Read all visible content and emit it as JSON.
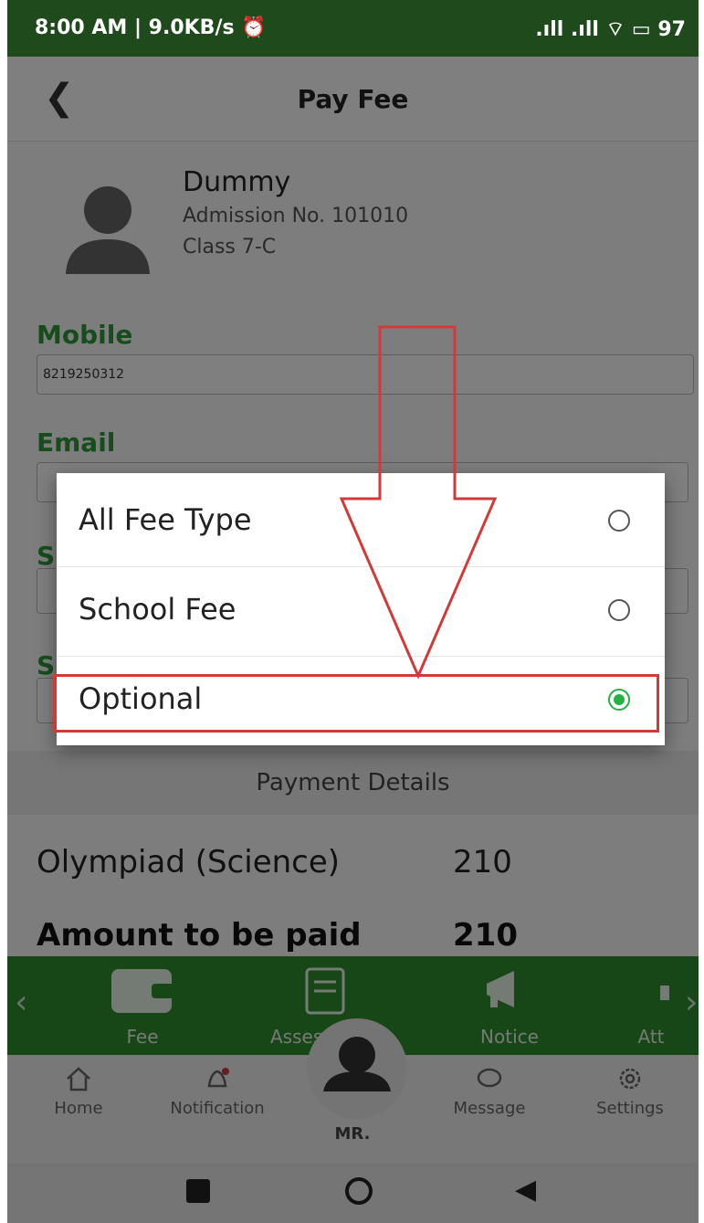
{
  "status": {
    "time": "8:00 AM | 9.0KB/s ⏰",
    "right": ".ıll .ıll ⌔ ▭ 97"
  },
  "header": {
    "title": "Pay Fee"
  },
  "student": {
    "name": "Dummy",
    "admission": "Admission No. 101010",
    "class": "Class 7-C"
  },
  "form": {
    "mobile_label": "Mobile",
    "mobile_value": "8219250312",
    "email_label": "Email",
    "select1_label": "S",
    "select2_label": "S"
  },
  "payment": {
    "section_title": "Payment Details",
    "item_name": "Olympiad (Science)",
    "item_amount": "210",
    "total_label": "Amount to be paid",
    "total_amount": "210"
  },
  "shortcuts": [
    {
      "label": "Fee"
    },
    {
      "label": "Assessment"
    },
    {
      "label": "Notice"
    },
    {
      "label": "Att"
    }
  ],
  "bottom_nav": [
    {
      "label": "Home"
    },
    {
      "label": "Notification"
    },
    {
      "label": "MR."
    },
    {
      "label": "Message"
    },
    {
      "label": "Settings"
    }
  ],
  "dialog": {
    "options": [
      {
        "label": "All Fee Type",
        "selected": false
      },
      {
        "label": "School Fee",
        "selected": false
      },
      {
        "label": "Optional",
        "selected": true
      }
    ]
  },
  "colors": {
    "accent": "#2e9b3a",
    "bar": "#2f8f2c",
    "annotation": "#d23a3a"
  }
}
